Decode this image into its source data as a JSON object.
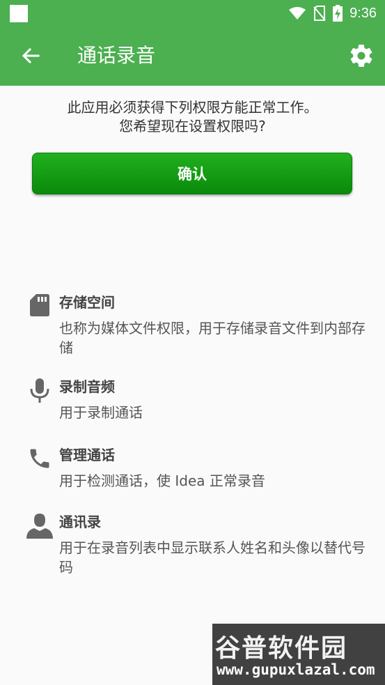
{
  "status_bar": {
    "time": "9:36"
  },
  "app_bar": {
    "title": "通话录音"
  },
  "prompt": {
    "line1": "此应用必须获得下列权限方能正常工作。",
    "line2": "您希望现在设置权限吗?"
  },
  "confirm_button": {
    "label": "确认"
  },
  "permissions": [
    {
      "icon": "sd-card-icon",
      "title": "存储空间",
      "description": "也称为媒体文件权限，用于存储录音文件到内部存储"
    },
    {
      "icon": "microphone-icon",
      "title": "录制音频",
      "description": "用于录制通话"
    },
    {
      "icon": "phone-icon",
      "title": "管理通话",
      "description": "用于检测通话，使 Idea 正常录音"
    },
    {
      "icon": "person-icon",
      "title": "通讯录",
      "description": "用于在录音列表中显示联系人姓名和头像以替代号码"
    }
  ],
  "watermark": {
    "title": "谷普软件园",
    "url": "www.gupuxlazal.com"
  },
  "colors": {
    "primary": "#4caf50",
    "button": "#119a11",
    "background": "#fafafa"
  }
}
